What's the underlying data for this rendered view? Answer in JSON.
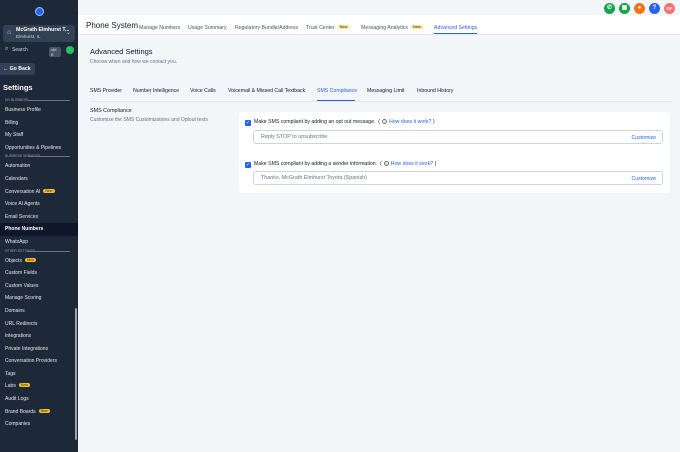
{
  "sidebar": {
    "location_name": "McGrath Elmhurst T...",
    "location_sub": "Elmhurst, IL",
    "search_label": "Search",
    "search_shortcut": "ctrl K",
    "go_back": "← Go Back",
    "title": "Settings",
    "sections": [
      {
        "label": "MY BUSINESS",
        "items": [
          {
            "label": "Business Profile"
          },
          {
            "label": "Billing"
          },
          {
            "label": "My Staff"
          },
          {
            "label": "Opportunities & Pipelines"
          }
        ]
      },
      {
        "label": "BUSINESS SERVICES",
        "items": [
          {
            "label": "Automation"
          },
          {
            "label": "Calendars"
          },
          {
            "label": "Conversation AI",
            "badge": "New"
          },
          {
            "label": "Voice AI Agents"
          },
          {
            "label": "Email Services"
          },
          {
            "label": "Phone Numbers",
            "active": true
          },
          {
            "label": "WhatsApp"
          }
        ]
      },
      {
        "label": "OTHER SETTINGS",
        "items": [
          {
            "label": "Objects",
            "badge": "New"
          },
          {
            "label": "Custom Fields"
          },
          {
            "label": "Custom Values"
          },
          {
            "label": "Manage Scoring"
          },
          {
            "label": "Domains"
          },
          {
            "label": "URL Redirects"
          },
          {
            "label": "Integrations"
          },
          {
            "label": "Private Integrations"
          },
          {
            "label": "Conversation Providers"
          },
          {
            "label": "Tags"
          },
          {
            "label": "Labs",
            "badge": "New"
          },
          {
            "label": "Audit Logs"
          },
          {
            "label": "Brand Boards",
            "badge": "New"
          },
          {
            "label": "Companies"
          }
        ]
      }
    ]
  },
  "header": {
    "title": "Phone System",
    "tabs": [
      {
        "label": "Manage Numbers"
      },
      {
        "label": "Usage Summary"
      },
      {
        "label": "Regulatory Bundle/Address"
      },
      {
        "label": "Trust Center",
        "badge": "New"
      },
      {
        "label": "Messaging Analytics",
        "badge": "New"
      },
      {
        "label": "Advanced Settings",
        "active": true
      }
    ],
    "icons": [
      {
        "name": "phone-icon",
        "color": "#16a34a",
        "glyph": "✆"
      },
      {
        "name": "megaphone-icon",
        "color": "#16a34a",
        "glyph": "▣"
      },
      {
        "name": "bell-icon",
        "color": "#f97316",
        "glyph": "●"
      },
      {
        "name": "help-icon",
        "color": "#2563eb",
        "glyph": "?"
      },
      {
        "name": "avatar",
        "color": "#f87171",
        "glyph": "GF"
      }
    ]
  },
  "main": {
    "title": "Advanced Settings",
    "subtitle": "Choose when and how we contact you.",
    "tabs": [
      {
        "label": "SMS Provider"
      },
      {
        "label": "Number Intelligence"
      },
      {
        "label": "Voice Calls"
      },
      {
        "label": "Voicemail & Missed Call Textback"
      },
      {
        "label": "SMS Compliance",
        "active": true
      },
      {
        "label": "Messaging Limit"
      },
      {
        "label": "Inbound History"
      }
    ],
    "section_title": "SMS Compliance",
    "section_desc": "Customize the SMS Customizations and Optout texts",
    "options": [
      {
        "label": "Make SMS compliant by adding an opt out message.",
        "how_link": "How does it work?",
        "value": "Reply STOP to unsubscribe",
        "customize": "Customize"
      },
      {
        "label": "Make SMS compliant by adding a sender information.",
        "how_link": "How does it work?",
        "value": "Thanks, McGrath Elmhurst Toyota (Spanish)",
        "customize": "Customize"
      }
    ]
  },
  "colors": {
    "accent": "#2563eb",
    "sidebar_bg": "#1d2939",
    "page_bg": "#f3f6f9"
  }
}
